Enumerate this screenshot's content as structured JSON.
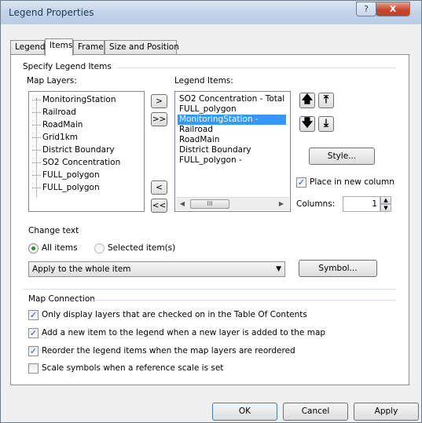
{
  "window": {
    "title": "Legend Properties",
    "help_glyph": "?",
    "close_glyph": "X"
  },
  "tabs": [
    {
      "label": "Legend"
    },
    {
      "label": "Items"
    },
    {
      "label": "Frame"
    },
    {
      "label": "Size and Position"
    }
  ],
  "specify": {
    "group_title": "Specify Legend Items",
    "map_layers_label": "Map Layers:",
    "map_layers": [
      "MonitoringStation",
      "Railroad",
      "RoadMain",
      "Grid1km",
      "District Boundary",
      "SO2 Concentration",
      "FULL_polygon",
      "FULL_polygon"
    ],
    "legend_items_label": "Legend Items:",
    "legend_items": [
      "SO2 Concentration - Total",
      "FULL_polygon",
      "MonitoringStation -",
      "Railroad",
      "RoadMain",
      "District Boundary",
      "FULL_polygon -"
    ],
    "selected_legend_item_index": 2,
    "btn_add": ">",
    "btn_add_all": ">>",
    "btn_remove": "<",
    "btn_remove_all": "<<",
    "scroll_thumb": "III",
    "move_up": "🡅",
    "move_top": "⤒",
    "move_down": "🡇",
    "move_bottom": "⤓",
    "style_button": "Style...",
    "place_in_new_column": "Place in new column",
    "place_in_new_column_checked": true,
    "columns_label": "Columns:",
    "columns_value": "1"
  },
  "change_text": {
    "label": "Change text",
    "radio_all": "All items",
    "radio_selected": "Selected item(s)",
    "selected": "all",
    "apply_value": "Apply to the whole item",
    "symbol_button": "Symbol..."
  },
  "map_connection": {
    "group_title": "Map Connection",
    "options": [
      {
        "label": "Only display layers that are checked on in the Table Of Contents",
        "checked": true
      },
      {
        "label": "Add a new item to the legend when a new layer is added to the map",
        "checked": true
      },
      {
        "label": "Reorder the legend items when the map layers are reordered",
        "checked": true
      },
      {
        "label": "Scale symbols when a reference scale is set",
        "checked": false
      }
    ]
  },
  "footer": {
    "ok": "OK",
    "cancel": "Cancel",
    "apply": "Apply"
  },
  "colors": {
    "selection": "#3399ff",
    "titlebar": "#c3d4e8",
    "close": "#c9462c"
  }
}
